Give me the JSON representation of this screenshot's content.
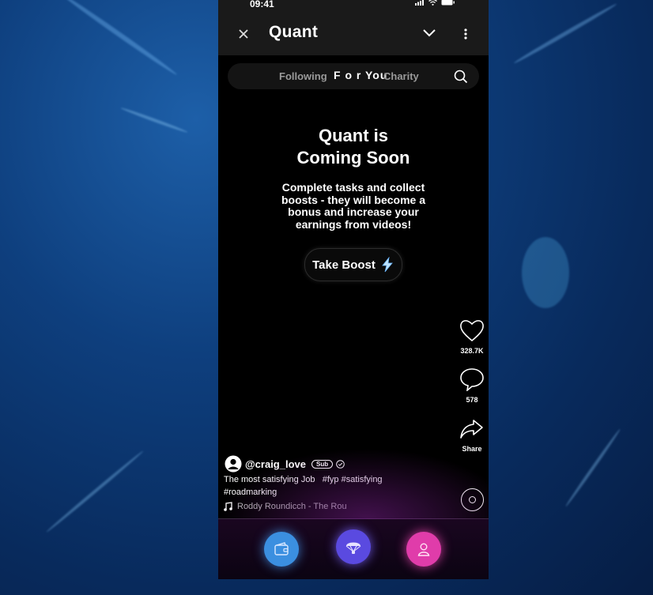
{
  "status": {
    "time": "09:41"
  },
  "header": {
    "title": "Quant"
  },
  "tabs": [
    {
      "label": "Following",
      "active": false
    },
    {
      "label": "F o r You",
      "active": true
    },
    {
      "label": "Charity",
      "active": false
    }
  ],
  "hero": {
    "title_line1": "Quant is",
    "title_line2": "Coming Soon",
    "subtitle": "Complete tasks and collect boosts - they will become a bonus and increase your earnings from videos!",
    "button_label": "Take Boost"
  },
  "actions": {
    "likes": "328.7K",
    "comments": "578",
    "share": "Share"
  },
  "post": {
    "username": "@craig_love",
    "badge": "Sub",
    "caption_text": "The most satisfying Job",
    "hashtags_line1": "#fyp #satisfying",
    "hashtags_line2": "#roadmarking",
    "music": "Roddy Roundicch - The Rou"
  },
  "nav": {
    "colors": {
      "left": "#3b8fe0",
      "center": "#5a4ae0",
      "right": "#e03caa"
    },
    "icons": [
      "wallet-icon",
      "parachute-icon",
      "profile-icon"
    ]
  }
}
